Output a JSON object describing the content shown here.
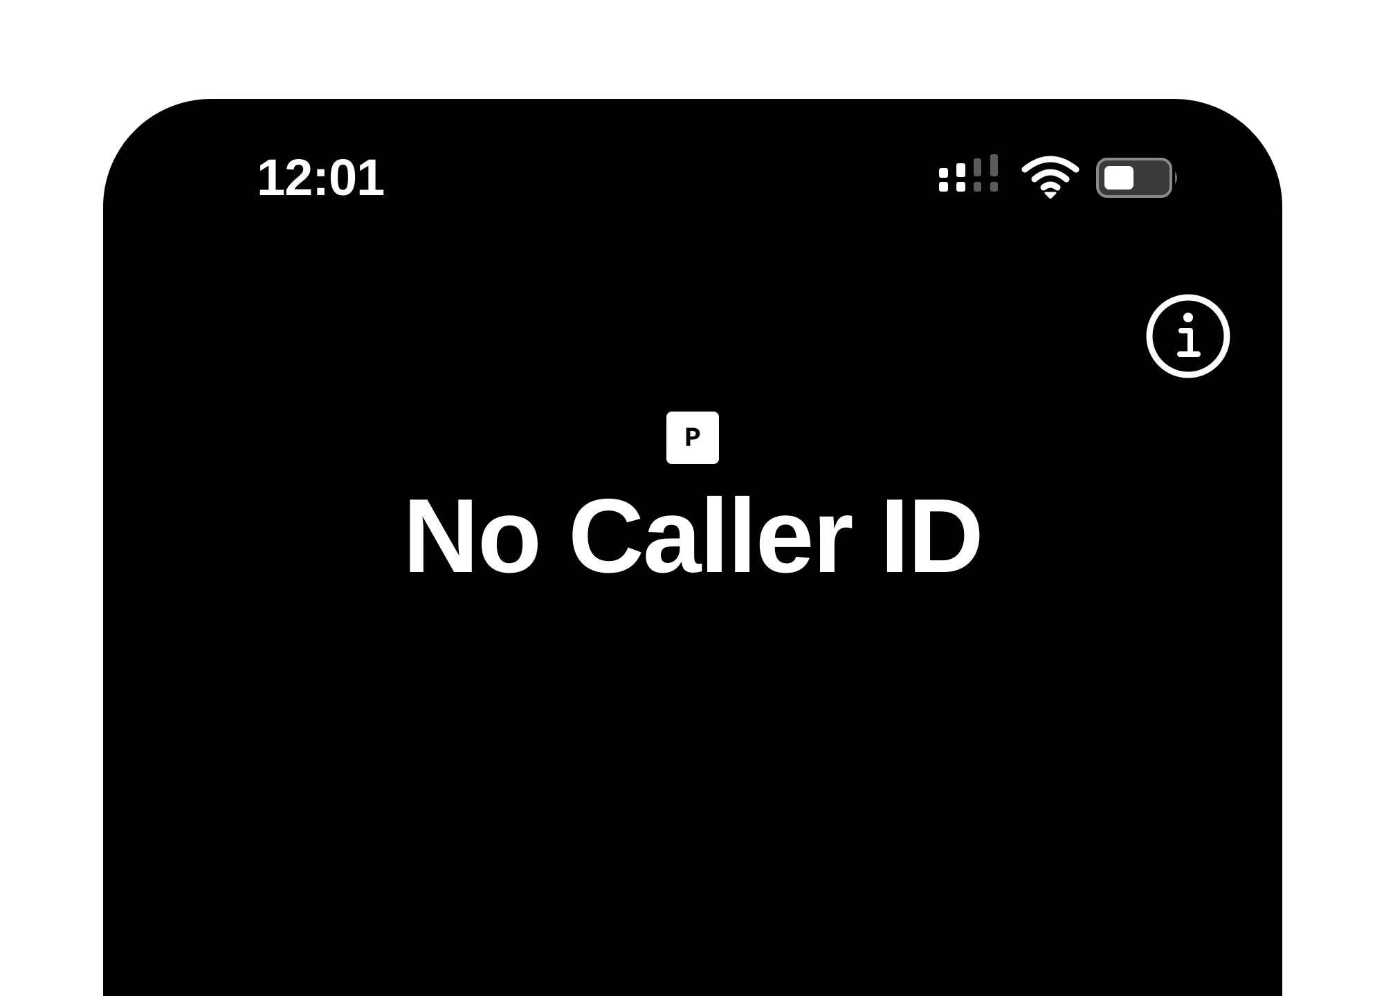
{
  "status_bar": {
    "time": "12:01",
    "icons": [
      "cellular-signal-icon",
      "wifi-icon",
      "battery-icon"
    ]
  },
  "call_screen": {
    "info_icon": "info-icon",
    "badge_letter": "P",
    "caller_name": "No Caller ID"
  },
  "colors": {
    "background": "#000000",
    "foreground": "#ffffff",
    "page": "#ffffff",
    "dim_signal": "#5a5a5a",
    "battery_fill": "#ffffff",
    "battery_shell": "#6f6f6f"
  }
}
